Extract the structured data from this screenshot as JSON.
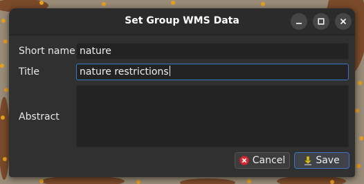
{
  "window": {
    "title": "Set Group WMS Data",
    "controls": {
      "minimize_icon": "minimize-icon",
      "maximize_icon": "maximize-icon",
      "close_icon": "close-icon"
    }
  },
  "form": {
    "short_name_label": "Short name",
    "short_name_value": "nature",
    "title_label": "Title",
    "title_value": "nature restrictions",
    "abstract_label": "Abstract",
    "abstract_value": ""
  },
  "buttons": {
    "cancel_label": "Cancel",
    "cancel_icon": "cancel-icon",
    "save_label": "Save",
    "save_icon": "save-arrow-icon"
  },
  "colors": {
    "dialog_bg": "#303030",
    "field_bg": "#232323",
    "focus_border": "#3b77c4",
    "cancel_icon": "#d9262c",
    "save_icon": "#e0c020"
  }
}
